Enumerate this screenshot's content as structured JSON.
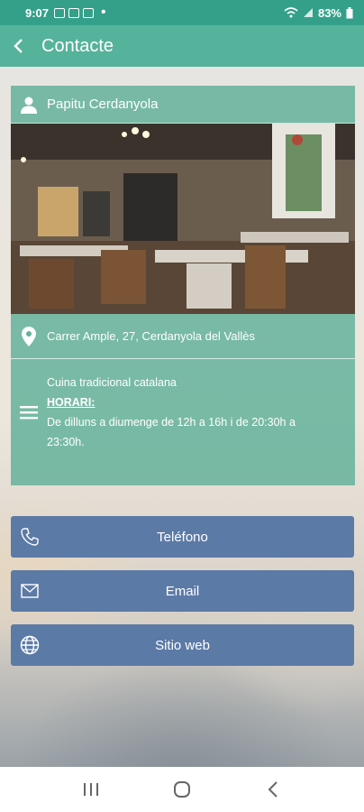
{
  "status_bar": {
    "time": "9:07",
    "battery": "83%"
  },
  "app_bar": {
    "title": "Contacte"
  },
  "card": {
    "name": "Papitu Cerdanyola",
    "address": "Carrer Ample, 27, Cerdanyola del Vallès",
    "description": "Cuina tradicional catalana",
    "hours_header": "HORARI:",
    "hours_line1": "De dilluns a diumenge de 12h a 16h i de 20:30h a",
    "hours_line2": "23:30h."
  },
  "buttons": {
    "phone": "Teléfono",
    "email": "Email",
    "website": "Sitio web"
  },
  "icons": [
    "back-arrow-icon",
    "person-icon",
    "location-pin-icon",
    "menu-lines-icon",
    "phone-icon",
    "mail-icon",
    "globe-icon",
    "recents-icon",
    "home-icon",
    "back-nav-icon"
  ],
  "colors": {
    "status_bar": "#34a08a",
    "app_bar": "#55b39b",
    "card": "#64b29b",
    "button": "#5c7aa6"
  }
}
